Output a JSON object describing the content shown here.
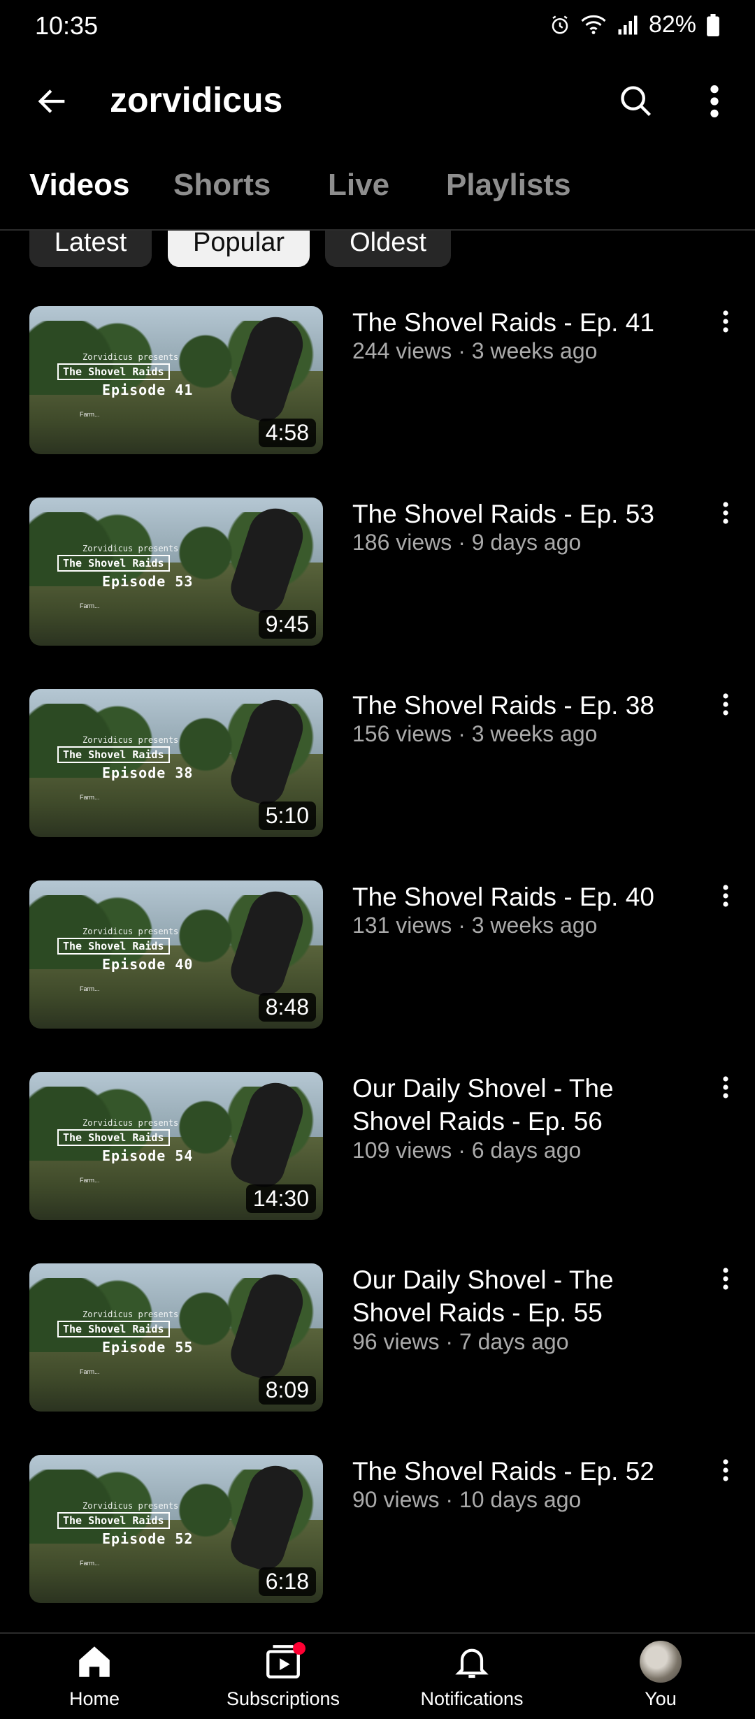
{
  "status_bar": {
    "time": "10:35",
    "battery": "82%",
    "icons": [
      "alarm-icon",
      "wifi-icon",
      "signal-icon",
      "battery-icon"
    ]
  },
  "app_bar": {
    "title": "zorvidicus",
    "icons": [
      "back-arrow-icon",
      "search-icon",
      "more-vert-icon"
    ]
  },
  "tabs": [
    {
      "label": "Videos",
      "active": true
    },
    {
      "label": "Shorts",
      "active": false
    },
    {
      "label": "Live",
      "active": false
    },
    {
      "label": "Playlists",
      "active": false
    }
  ],
  "chips": [
    {
      "label": "Latest",
      "selected": false
    },
    {
      "label": "Popular",
      "selected": true
    },
    {
      "label": "Oldest",
      "selected": false
    }
  ],
  "videos": [
    {
      "title": "The Shovel Raids - Ep. 41",
      "meta": "244 views · 3 weeks ago",
      "duration": "4:58",
      "thumb_episode": "Episode 41"
    },
    {
      "title": "The Shovel Raids - Ep. 53",
      "meta": "186 views · 9 days ago",
      "duration": "9:45",
      "thumb_episode": "Episode 53"
    },
    {
      "title": "The Shovel Raids - Ep. 38",
      "meta": "156 views · 3 weeks ago",
      "duration": "5:10",
      "thumb_episode": "Episode 38"
    },
    {
      "title": "The Shovel Raids - Ep. 40",
      "meta": "131 views · 3 weeks ago",
      "duration": "8:48",
      "thumb_episode": "Episode 40"
    },
    {
      "title": "Our Daily Shovel - The Shovel Raids - Ep. 56",
      "meta": "109 views · 6 days ago",
      "duration": "14:30",
      "thumb_episode": "Episode 54"
    },
    {
      "title": "Our Daily Shovel - The Shovel Raids - Ep. 55",
      "meta": "96 views · 7 days ago",
      "duration": "8:09",
      "thumb_episode": "Episode 55"
    },
    {
      "title": "The Shovel Raids - Ep. 52",
      "meta": "90 views · 10 days ago",
      "duration": "6:18",
      "thumb_episode": "Episode 52"
    }
  ],
  "thumb_overlay": {
    "presents": "Zorvidicus presents",
    "series": "The Shovel Raids",
    "farm": "Farm..."
  },
  "bottom_nav": [
    {
      "label": "Home",
      "icon": "home-icon"
    },
    {
      "label": "Subscriptions",
      "icon": "subscriptions-icon"
    },
    {
      "label": "Notifications",
      "icon": "bell-icon"
    },
    {
      "label": "You",
      "icon": "avatar"
    }
  ],
  "colors": {
    "background": "#000000",
    "secondary_text": "#aaaaaa",
    "chip_bg": "#272727",
    "chip_selected_bg": "#f1f1f1",
    "badge": "#ff0033"
  }
}
